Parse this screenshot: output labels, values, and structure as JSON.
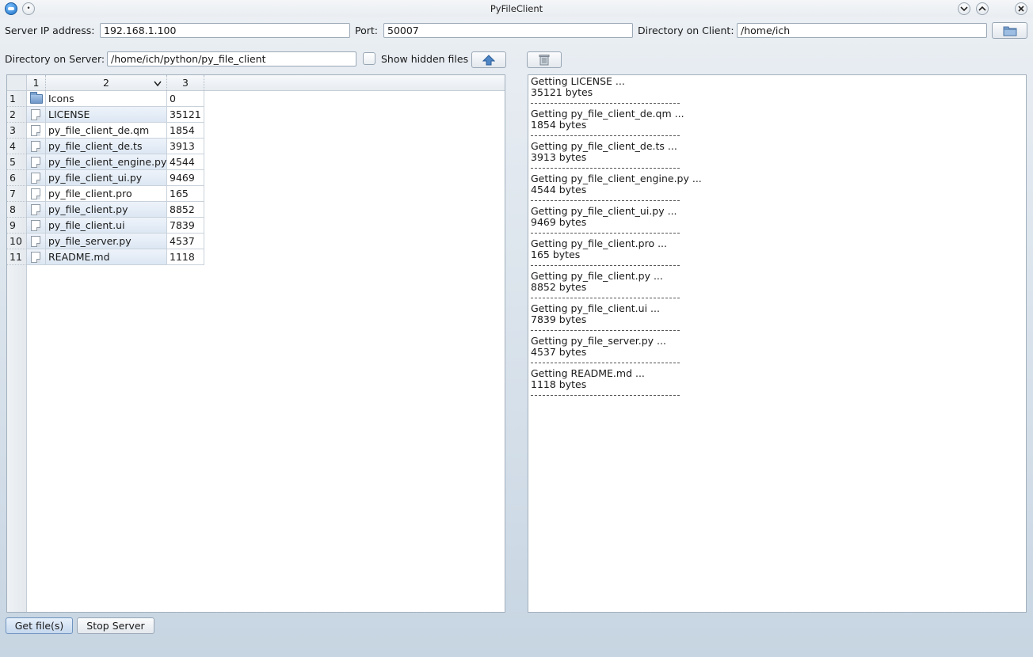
{
  "window": {
    "title": "PyFileClient"
  },
  "connection": {
    "server_ip_label": "Server IP address:",
    "server_ip_value": "192.168.1.100",
    "port_label": "Port:",
    "port_value": "50007",
    "client_dir_label": "Directory on Client:",
    "client_dir_value": "/home/ich"
  },
  "server_dir": {
    "label": "Directory on Server:",
    "value": "/home/ich/python/py_file_client",
    "show_hidden_label": "Show hidden files"
  },
  "table": {
    "columns": [
      "1",
      "2",
      "3"
    ],
    "rows": [
      {
        "num": "1",
        "type": "folder",
        "name": "Icons",
        "size": "0",
        "selected": false
      },
      {
        "num": "2",
        "type": "file",
        "name": "LICENSE",
        "size": "35121",
        "selected": true
      },
      {
        "num": "3",
        "type": "file",
        "name": "py_file_client_de.qm",
        "size": "1854",
        "selected": false
      },
      {
        "num": "4",
        "type": "file",
        "name": "py_file_client_de.ts",
        "size": "3913",
        "selected": true
      },
      {
        "num": "5",
        "type": "file",
        "name": "py_file_client_engine.py",
        "size": "4544",
        "selected": true
      },
      {
        "num": "6",
        "type": "file",
        "name": "py_file_client_ui.py",
        "size": "9469",
        "selected": true
      },
      {
        "num": "7",
        "type": "file",
        "name": "py_file_client.pro",
        "size": "165",
        "selected": false
      },
      {
        "num": "8",
        "type": "file",
        "name": "py_file_client.py",
        "size": "8852",
        "selected": true
      },
      {
        "num": "9",
        "type": "file",
        "name": "py_file_client.ui",
        "size": "7839",
        "selected": true
      },
      {
        "num": "10",
        "type": "file",
        "name": "py_file_server.py",
        "size": "4537",
        "selected": true
      },
      {
        "num": "11",
        "type": "file",
        "name": "README.md",
        "size": "1118",
        "selected": true
      }
    ]
  },
  "log": [
    {
      "getting": "Getting LICENSE ...",
      "bytes": "35121 bytes"
    },
    {
      "getting": "Getting py_file_client_de.qm ...",
      "bytes": "1854 bytes"
    },
    {
      "getting": "Getting py_file_client_de.ts ...",
      "bytes": "3913 bytes"
    },
    {
      "getting": "Getting py_file_client_engine.py ...",
      "bytes": "4544 bytes"
    },
    {
      "getting": "Getting py_file_client_ui.py ...",
      "bytes": "9469 bytes"
    },
    {
      "getting": "Getting py_file_client.pro ...",
      "bytes": "165 bytes"
    },
    {
      "getting": "Getting py_file_client.py ...",
      "bytes": "8852 bytes"
    },
    {
      "getting": "Getting py_file_client.ui ...",
      "bytes": "7839 bytes"
    },
    {
      "getting": "Getting py_file_server.py ...",
      "bytes": "4537 bytes"
    },
    {
      "getting": "Getting README.md ...",
      "bytes": "1118 bytes"
    }
  ],
  "buttons": {
    "get_files": "Get file(s)",
    "stop_server": "Stop Server"
  },
  "icons": {
    "app": "app-icon",
    "browse_client_dir": "folder-icon",
    "up_dir": "arrow-up-icon",
    "clear_log": "trash-icon",
    "folder_row": "folder-icon",
    "file_row": "file-icon"
  }
}
